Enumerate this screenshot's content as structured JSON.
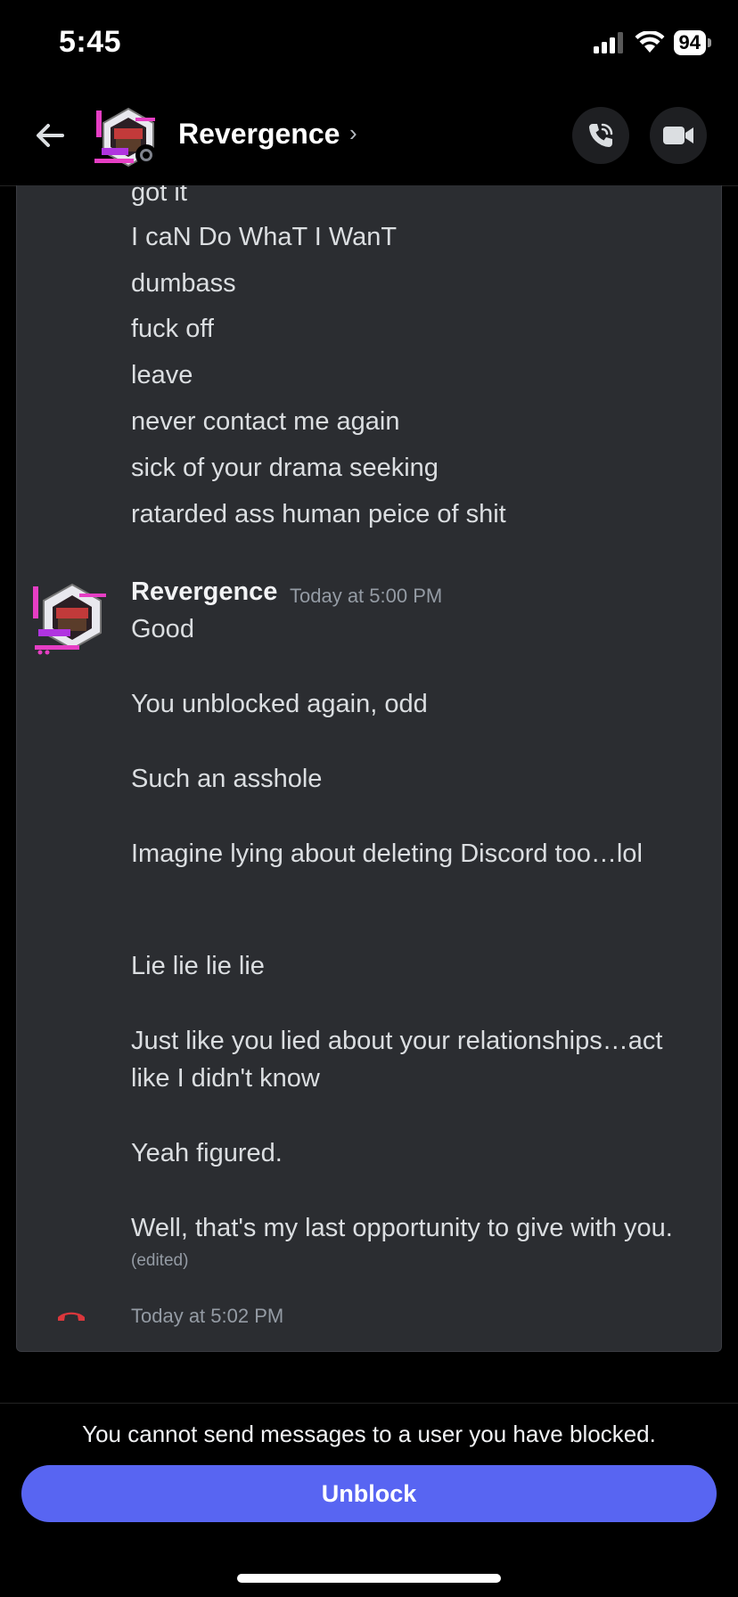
{
  "status_bar": {
    "time": "5:45",
    "battery": "94"
  },
  "header": {
    "title": "Revergence",
    "chevron": "›"
  },
  "icons": {
    "back": "arrow-left-icon",
    "call": "phone-icon",
    "video": "video-camera-icon",
    "missed_call": "phone-hangup-icon"
  },
  "colors": {
    "accent": "#5865f2",
    "missed_call": "#da373c",
    "panel": "#2b2d31"
  },
  "messages_before": [
    "got it",
    "I caN Do WhaT I WanT",
    "dumbass",
    "fuck off",
    "leave",
    "never contact me again",
    "sick of your drama seeking",
    "ratarded ass human peice of shit"
  ],
  "message_group": {
    "author": "Revergence",
    "timestamp": "Today at 5:00 PM",
    "lines": [
      "Good",
      "You unblocked again, odd",
      "Such an asshole",
      "Imagine lying about deleting Discord too…lol",
      "Lie lie lie lie",
      "Just like you lied about your relationships…act",
      "like I didn't know",
      "Yeah figured.",
      "Well, that's my last opportunity to give with you."
    ],
    "edited": "(edited)"
  },
  "call_event": {
    "timestamp": "Today at 5:02 PM"
  },
  "footer": {
    "blocked_notice": "You cannot send messages to a user you have blocked.",
    "unblock_label": "Unblock"
  }
}
